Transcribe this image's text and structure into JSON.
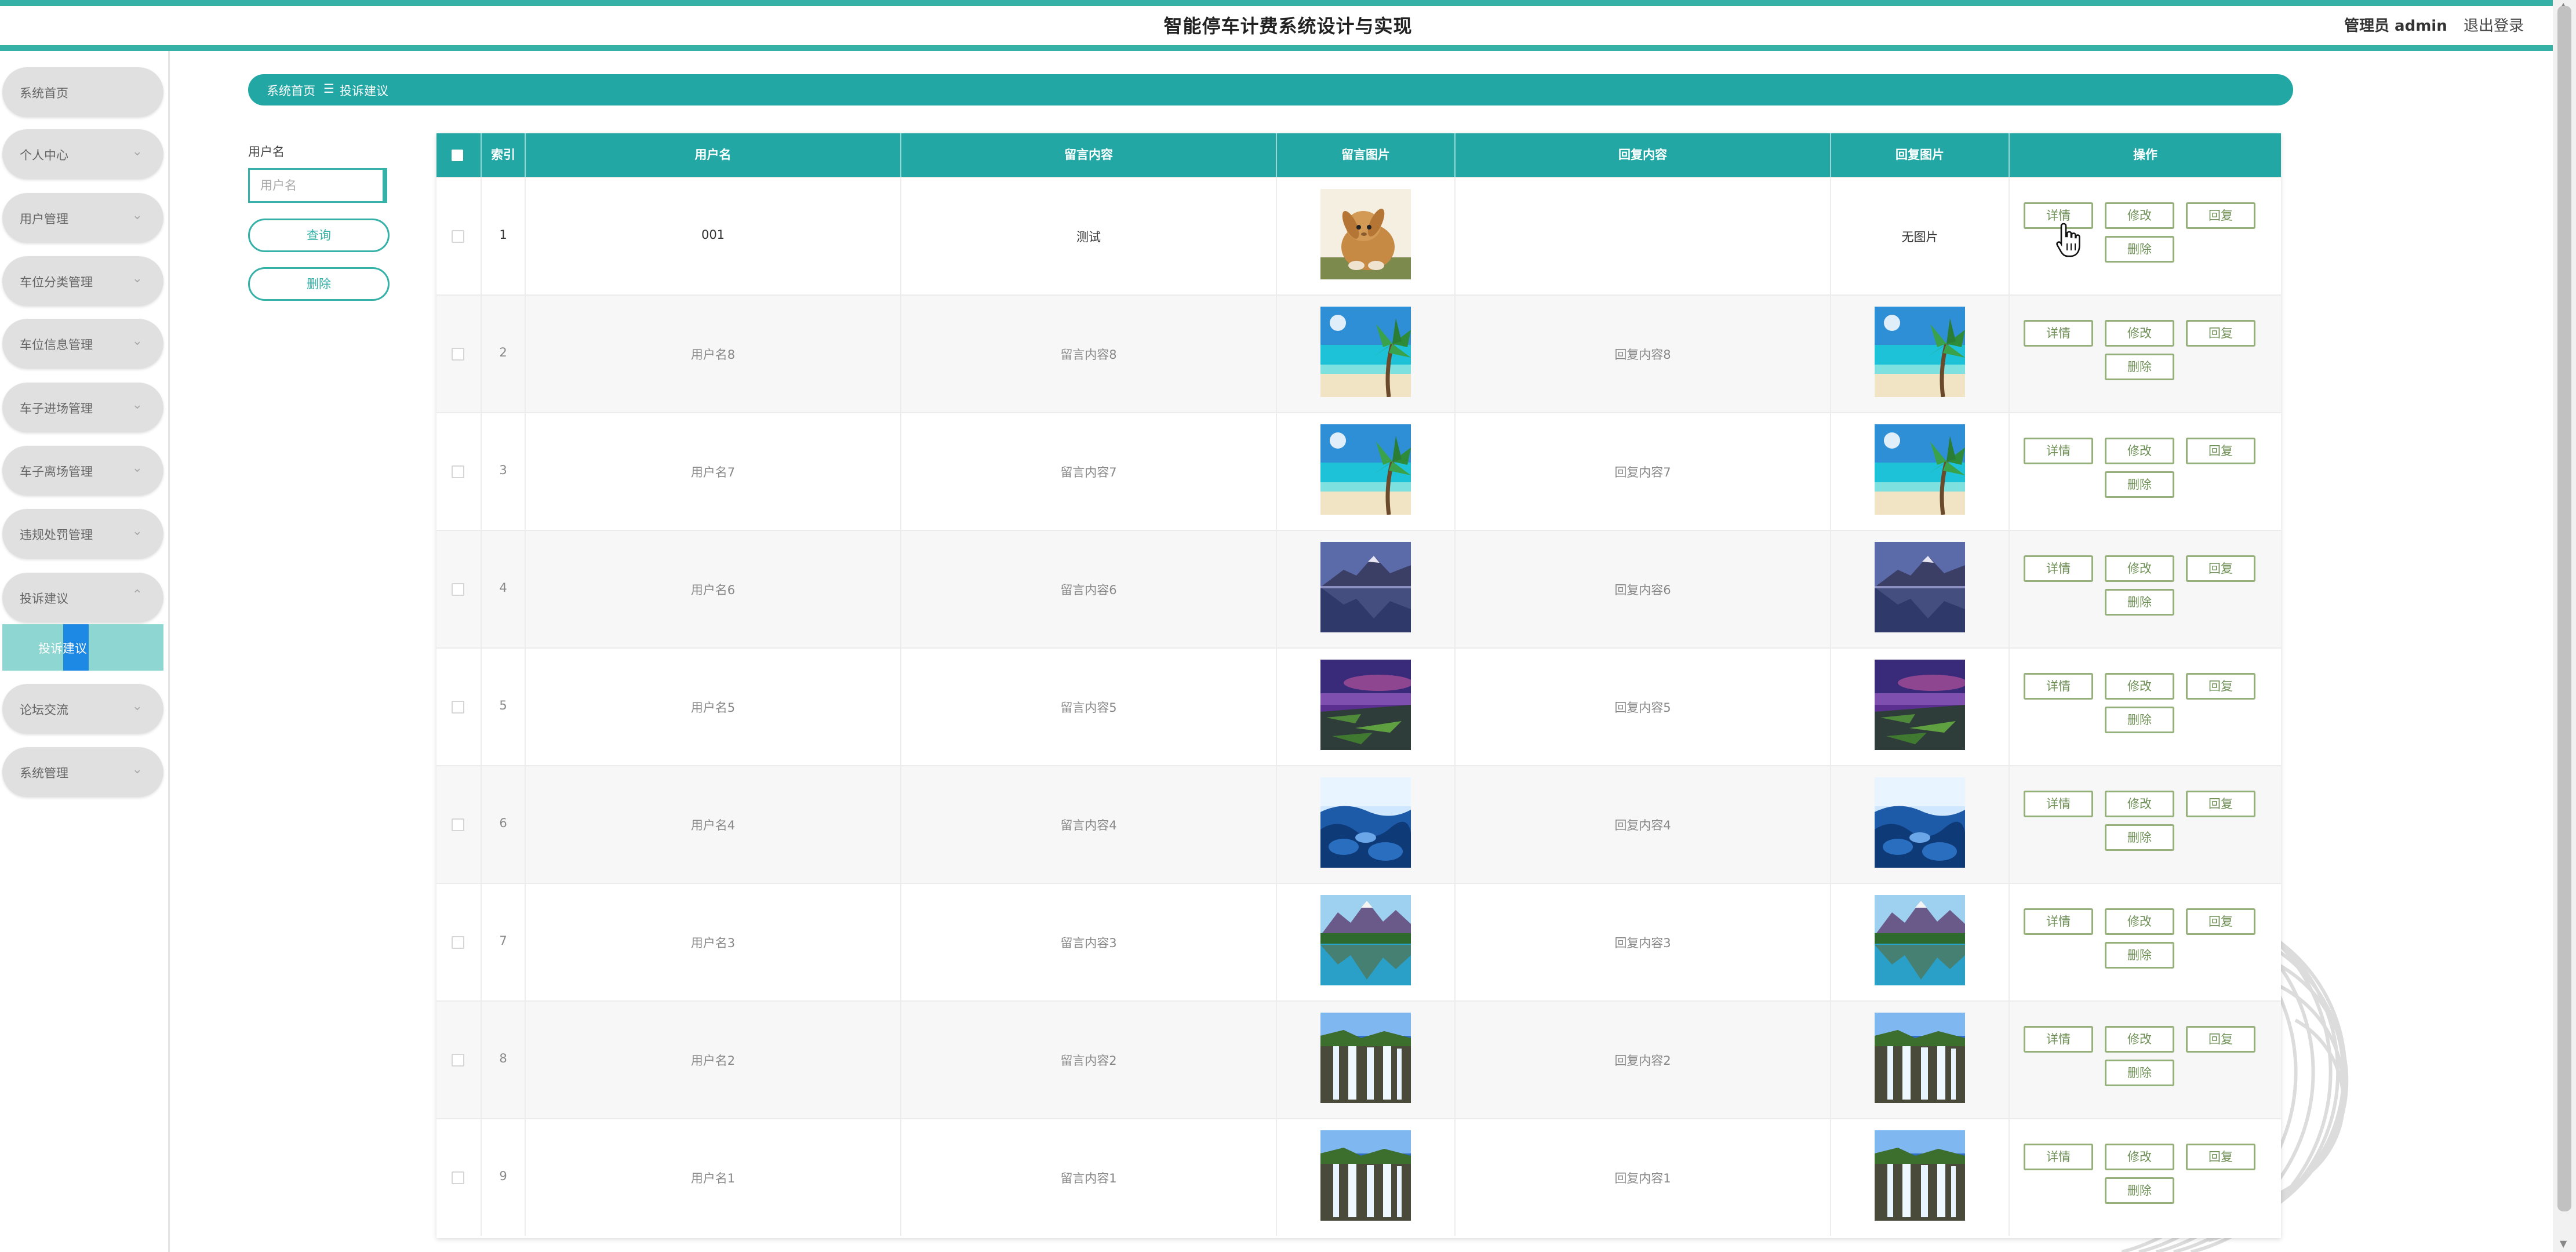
{
  "header": {
    "title": "智能停车计费系统设计与实现",
    "user": "管理员 admin",
    "logout": "退出登录"
  },
  "sidebar": {
    "items": [
      {
        "label": "系统首页",
        "chevron": false
      },
      {
        "label": "个人中心",
        "chevron": true
      },
      {
        "label": "用户管理",
        "chevron": true
      },
      {
        "label": "车位分类管理",
        "chevron": true
      },
      {
        "label": "车位信息管理",
        "chevron": true
      },
      {
        "label": "车子进场管理",
        "chevron": true
      },
      {
        "label": "车子离场管理",
        "chevron": true
      },
      {
        "label": "违规处罚管理",
        "chevron": true
      },
      {
        "label": "投诉建议",
        "chevron": true,
        "expanded": true
      },
      {
        "label": "论坛交流",
        "chevron": true
      },
      {
        "label": "系统管理",
        "chevron": true
      }
    ],
    "active_sub": "投诉建议"
  },
  "breadcrumb": {
    "home": "系统首页",
    "separator": "☰",
    "current": "投诉建议"
  },
  "search": {
    "label": "用户名",
    "placeholder": "用户名",
    "query_button": "查询",
    "delete_button": "删除"
  },
  "table": {
    "columns": [
      "索引",
      "用户名",
      "留言内容",
      "留言图片",
      "回复内容",
      "回复图片",
      "操作"
    ],
    "buttons": {
      "detail": "详情",
      "edit": "修改",
      "reply": "回复",
      "delete": "删除"
    },
    "no_image_text": "无图片",
    "rows": [
      {
        "index": "1",
        "username": "001",
        "message": "测试",
        "message_image": "rabbit",
        "reply": "",
        "reply_image": "none"
      },
      {
        "index": "2",
        "username": "用户名8",
        "message": "留言内容8",
        "message_image": "beach",
        "reply": "回复内容8",
        "reply_image": "beach"
      },
      {
        "index": "3",
        "username": "用户名7",
        "message": "留言内容7",
        "message_image": "beach",
        "reply": "回复内容7",
        "reply_image": "beach"
      },
      {
        "index": "4",
        "username": "用户名6",
        "message": "留言内容6",
        "message_image": "lake-mountain",
        "reply": "回复内容6",
        "reply_image": "lake-mountain"
      },
      {
        "index": "5",
        "username": "用户名5",
        "message": "留言内容5",
        "message_image": "purple-shore",
        "reply": "回复内容5",
        "reply_image": "purple-shore"
      },
      {
        "index": "6",
        "username": "用户名4",
        "message": "留言内容4",
        "message_image": "blue-rocks",
        "reply": "回复内容4",
        "reply_image": "blue-rocks"
      },
      {
        "index": "7",
        "username": "用户名3",
        "message": "留言内容3",
        "message_image": "mountain-lake",
        "reply": "回复内容3",
        "reply_image": "mountain-lake"
      },
      {
        "index": "8",
        "username": "用户名2",
        "message": "留言内容2",
        "message_image": "waterfall",
        "reply": "回复内容2",
        "reply_image": "waterfall"
      },
      {
        "index": "9",
        "username": "用户名1",
        "message": "留言内容1",
        "message_image": "waterfall",
        "reply": "回复内容1",
        "reply_image": "waterfall"
      }
    ]
  },
  "colors": {
    "accent": "#22a7a4",
    "accent_light": "#8ed6d1",
    "op_button_border": "#95b07a",
    "active_marker": "#1e88e5"
  }
}
